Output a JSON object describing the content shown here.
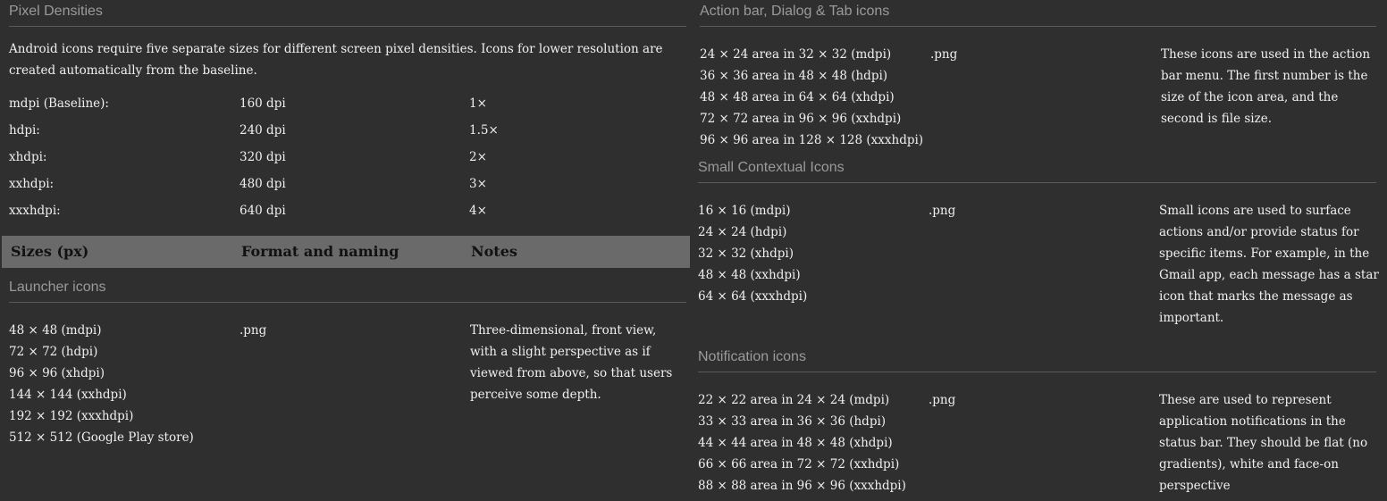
{
  "left": {
    "pixel_densities": {
      "title": "Pixel Densities",
      "intro": "Android icons require five separate sizes for different screen pixel densities. Icons for lower resolution are created automatically from the baseline.",
      "rows": [
        {
          "name": "mdpi (Baseline):",
          "dpi": "160 dpi",
          "scale": "1×"
        },
        {
          "name": "hdpi:",
          "dpi": "240 dpi",
          "scale": "1.5×"
        },
        {
          "name": "xhdpi:",
          "dpi": "320 dpi",
          "scale": "2×"
        },
        {
          "name": "xxhdpi:",
          "dpi": "480 dpi",
          "scale": "3×"
        },
        {
          "name": "xxxhdpi:",
          "dpi": "640 dpi",
          "scale": "4×"
        }
      ]
    },
    "table_header": {
      "sizes": "Sizes (px)",
      "format": "Format and naming",
      "notes": "Notes"
    },
    "launcher": {
      "title": "Launcher icons",
      "sizes": [
        "48 × 48 (mdpi)",
        "72 × 72 (hdpi)",
        "96 × 96 (xhdpi)",
        "144 × 144 (xxhdpi)",
        "192 × 192 (xxxhdpi)",
        "512 × 512 (Google Play store)"
      ],
      "format": ".png",
      "notes": [
        "Three-dimensional, front view,",
        "with a slight perspective as if",
        "viewed from above, so that users",
        "perceive some depth."
      ]
    }
  },
  "right": {
    "action_bar": {
      "title": "Action bar, Dialog & Tab icons",
      "sizes": [
        "24 × 24 area in 32 × 32 (mdpi)",
        "36 × 36 area in 48 × 48 (hdpi)",
        "48 × 48 area in 64 × 64 (xhdpi)",
        "72 × 72 area in 96 × 96 (xxhdpi)",
        "96 × 96 area in 128 × 128 (xxxhdpi)"
      ],
      "format": ".png",
      "notes": [
        "These icons are used in the action",
        "bar menu. The first number is the",
        "size of the icon area, and the",
        "second is file size."
      ]
    },
    "small_contextual": {
      "title": "Small Contextual Icons",
      "sizes": [
        "16 × 16 (mdpi)",
        "24 × 24 (hdpi)",
        "32 × 32 (xhdpi)",
        "48 × 48 (xxhdpi)",
        "64 × 64 (xxxhdpi)"
      ],
      "format": ".png",
      "notes": [
        "Small icons are used to surface",
        "actions and/or provide status for",
        "specific items. For example, in the",
        "Gmail app, each message has a star",
        "icon that marks the message as",
        "important."
      ]
    },
    "notification": {
      "title": "Notification icons",
      "sizes": [
        "22 × 22 area in 24 × 24 (mdpi)",
        "33 × 33 area in 36 × 36 (hdpi)",
        "44 × 44 area in 48 × 48 (xhdpi)",
        "66 × 66 area in 72 × 72 (xxhdpi)",
        "88 × 88 area in 96 × 96 (xxxhdpi)"
      ],
      "format": ".png",
      "notes": [
        "These are used to represent",
        "application notifications in the",
        "status bar. They should be flat (no",
        "gradients), white and face-on",
        "perspective"
      ]
    }
  }
}
